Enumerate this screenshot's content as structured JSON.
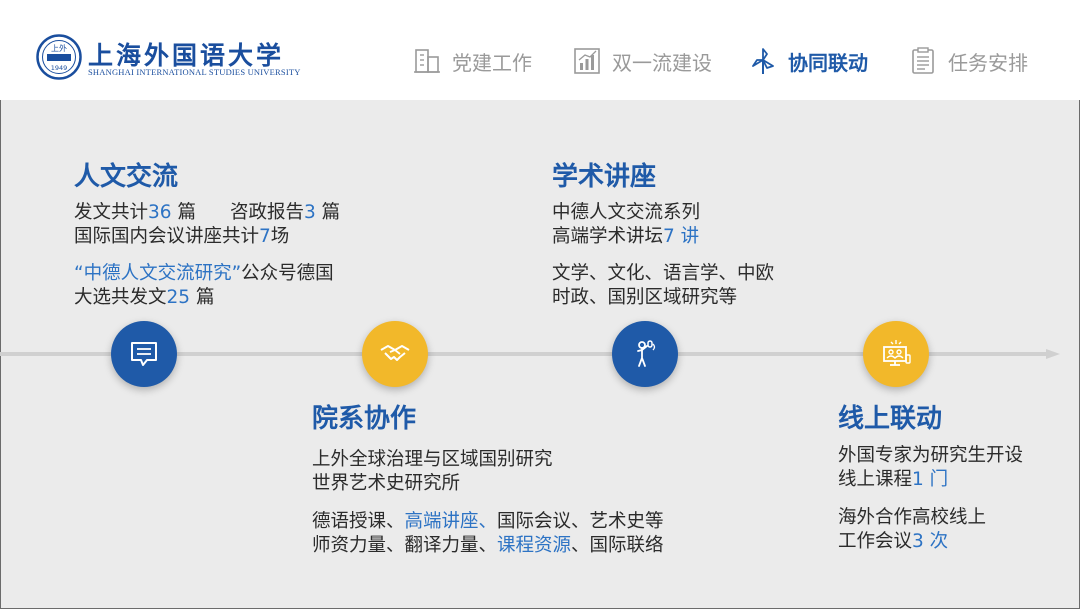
{
  "logo": {
    "name_cn": "上海外国语大学",
    "name_en": "SHANGHAI INTERNATIONAL STUDIES UNIVERSITY",
    "seal_top": "上外",
    "seal_year": "1949"
  },
  "nav": {
    "items": [
      {
        "label": "党建工作",
        "icon": "building-icon",
        "active": false
      },
      {
        "label": "双一流建设",
        "icon": "bar-chart-icon",
        "active": false
      },
      {
        "label": "协同联动",
        "icon": "pinwheel-icon",
        "active": true
      },
      {
        "label": "任务安排",
        "icon": "clipboard-icon",
        "active": false
      }
    ]
  },
  "colors": {
    "accent_blue": "#1f5aa8",
    "accent_gold": "#f2b82a",
    "highlight": "#2d73c4"
  },
  "sections": {
    "culture": {
      "title": "人文交流",
      "line1": {
        "a": "发文共计",
        "n": "36",
        "b": " 篇"
      },
      "line1b": {
        "a": "咨政报告",
        "n": "3",
        "b": " 篇"
      },
      "line2": {
        "a": "国际国内会议讲座共计",
        "n": "7",
        "b": "场"
      },
      "line3": {
        "q": "“中德人文交流研究”",
        "b": "公众号德国"
      },
      "line4": {
        "a": "大选共发文",
        "n": "25",
        "b": " 篇"
      },
      "icon": "chat-icon"
    },
    "lectures": {
      "title": "学术讲座",
      "line1": "中德人文交流系列",
      "line2": {
        "a": "高端学术讲坛",
        "n": "7 讲"
      },
      "line3": "文学、文化、语言学、中欧",
      "line4": "时政、国别区域研究等",
      "icon": "speaker-icon"
    },
    "institutes": {
      "title": "院系协作",
      "line1": "上外全球治理与区域国别研究",
      "line2": "世界艺术史研究所",
      "line3": {
        "a": "德语授课、",
        "h": "高端讲座、",
        "b": "国际会议、艺术史等"
      },
      "line4": {
        "a": "师资力量、翻译力量、",
        "h": "课程资源",
        "b": "、国际联络"
      },
      "icon": "handshake-icon"
    },
    "online": {
      "title": "线上联动",
      "line1": "外国专家为研究生开设",
      "line2": {
        "a": "线上课程",
        "n": "1 门"
      },
      "line3": "海外合作高校线上",
      "line4": {
        "a": "工作会议",
        "n": "3 次"
      },
      "icon": "online-meeting-icon"
    }
  }
}
